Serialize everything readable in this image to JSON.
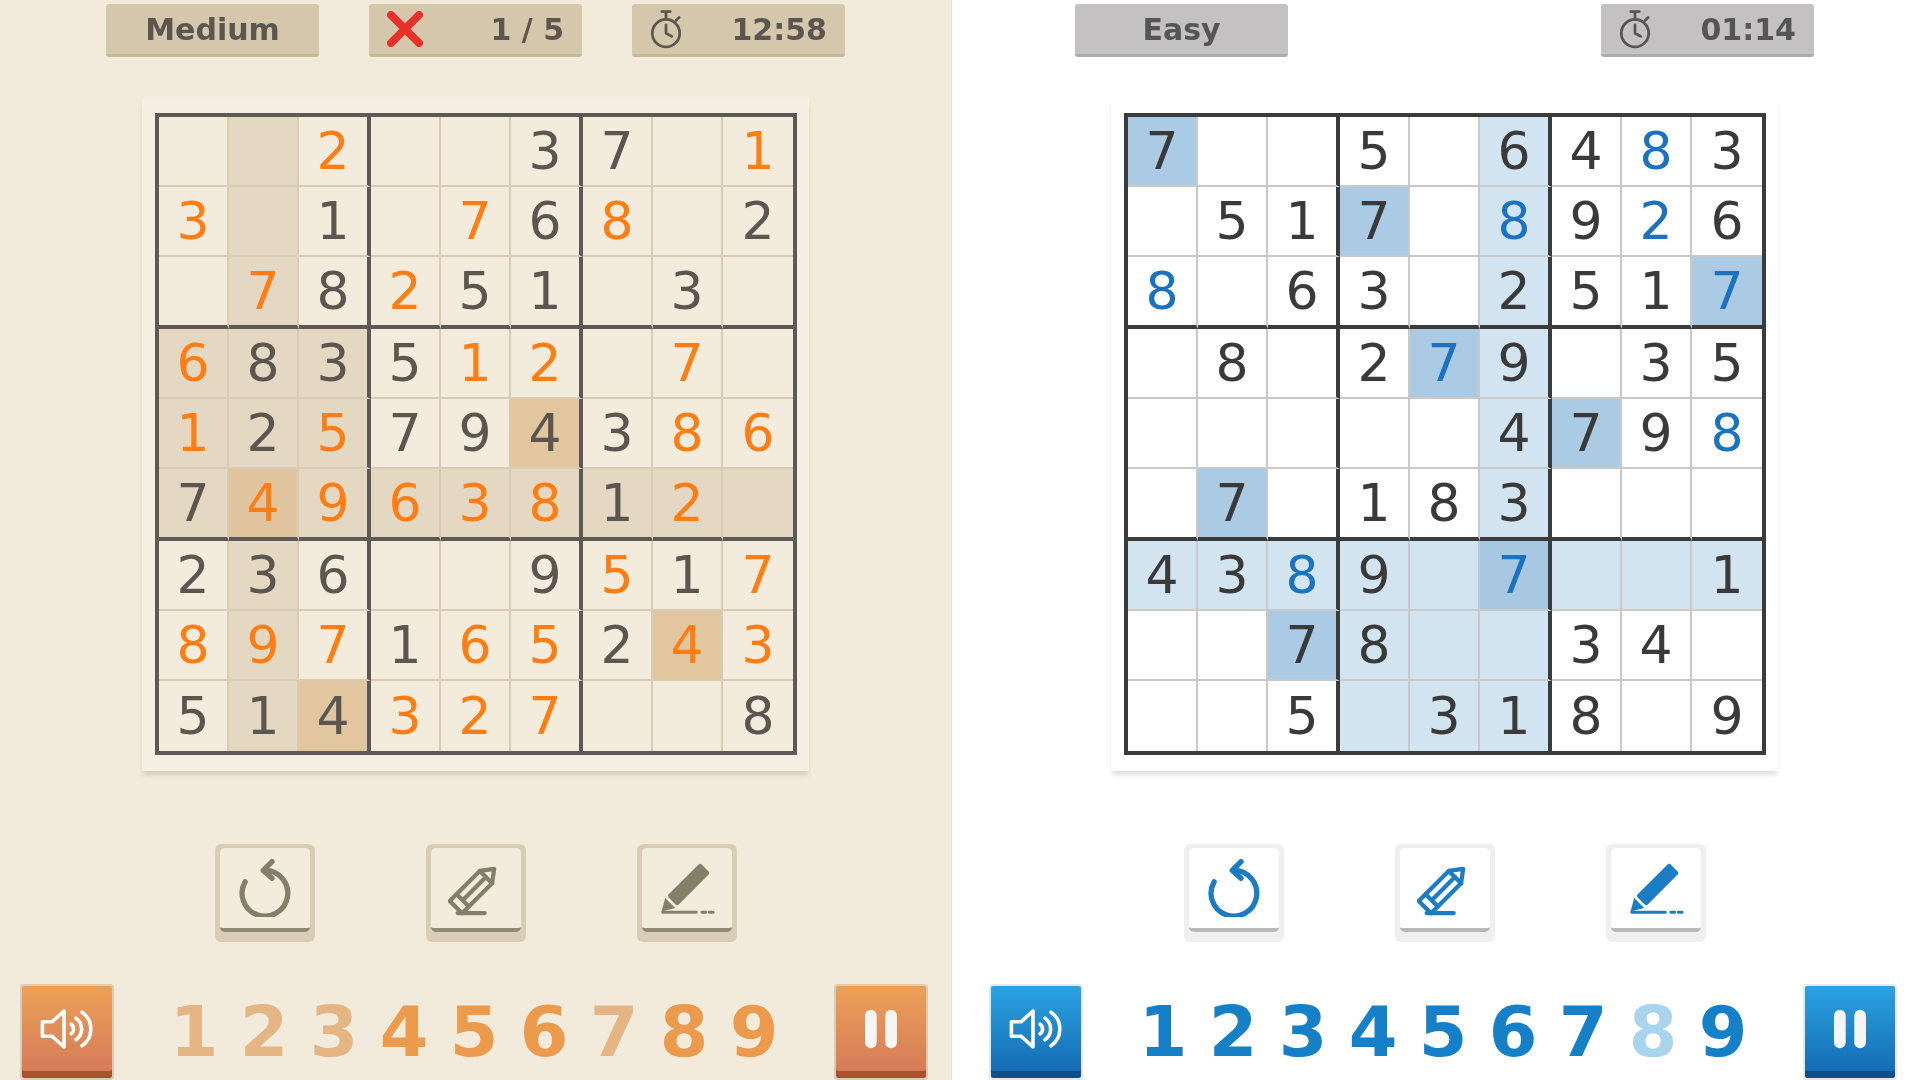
{
  "panels": [
    {
      "kind": "warm",
      "header": {
        "difficulty": "Medium",
        "mistakes": "1 / 5",
        "timer": "12:58"
      },
      "grid": [
        [
          {
            "kind": "empty",
            "highlighted": false,
            "matching": false
          },
          {
            "kind": "empty",
            "highlighted": true,
            "matching": false
          },
          {
            "value": "2",
            "kind": "entered",
            "highlighted": false,
            "matching": false
          },
          {
            "kind": "empty",
            "highlighted": false,
            "matching": false
          },
          {
            "kind": "empty",
            "highlighted": false,
            "matching": false
          },
          {
            "value": "3",
            "kind": "given",
            "highlighted": false,
            "matching": false
          },
          {
            "value": "7",
            "kind": "given",
            "highlighted": false,
            "matching": false
          },
          {
            "kind": "empty",
            "highlighted": false,
            "matching": false
          },
          {
            "value": "1",
            "kind": "entered",
            "highlighted": false,
            "matching": false
          }
        ],
        [
          {
            "value": "3",
            "kind": "entered",
            "highlighted": false,
            "matching": false
          },
          {
            "kind": "empty",
            "highlighted": true,
            "matching": false
          },
          {
            "value": "1",
            "kind": "given",
            "highlighted": false,
            "matching": false
          },
          {
            "kind": "empty",
            "highlighted": false,
            "matching": false
          },
          {
            "value": "7",
            "kind": "entered",
            "highlighted": false,
            "matching": false
          },
          {
            "value": "6",
            "kind": "given",
            "highlighted": false,
            "matching": false
          },
          {
            "value": "8",
            "kind": "entered",
            "highlighted": false,
            "matching": false
          },
          {
            "kind": "empty",
            "highlighted": false,
            "matching": false
          },
          {
            "value": "2",
            "kind": "given",
            "highlighted": false,
            "matching": false
          }
        ],
        [
          {
            "kind": "empty",
            "highlighted": false,
            "matching": false
          },
          {
            "value": "7",
            "kind": "entered",
            "highlighted": true,
            "matching": false
          },
          {
            "value": "8",
            "kind": "given",
            "highlighted": false,
            "matching": false
          },
          {
            "value": "2",
            "kind": "entered",
            "highlighted": false,
            "matching": false
          },
          {
            "value": "5",
            "kind": "given",
            "highlighted": false,
            "matching": false
          },
          {
            "value": "1",
            "kind": "given",
            "highlighted": false,
            "matching": false
          },
          {
            "kind": "empty",
            "highlighted": false,
            "matching": false
          },
          {
            "value": "3",
            "kind": "given",
            "highlighted": false,
            "matching": false
          },
          {
            "kind": "empty",
            "highlighted": false,
            "matching": false
          }
        ],
        [
          {
            "value": "6",
            "kind": "entered",
            "highlighted": true,
            "matching": false
          },
          {
            "value": "8",
            "kind": "given",
            "highlighted": true,
            "matching": false
          },
          {
            "value": "3",
            "kind": "given",
            "highlighted": true,
            "matching": false
          },
          {
            "value": "5",
            "kind": "given",
            "highlighted": false,
            "matching": false
          },
          {
            "value": "1",
            "kind": "entered",
            "highlighted": false,
            "matching": false
          },
          {
            "value": "2",
            "kind": "entered",
            "highlighted": false,
            "matching": false
          },
          {
            "kind": "empty",
            "highlighted": false,
            "matching": false
          },
          {
            "value": "7",
            "kind": "entered",
            "highlighted": false,
            "matching": false
          },
          {
            "kind": "empty",
            "highlighted": false,
            "matching": false
          }
        ],
        [
          {
            "value": "1",
            "kind": "entered",
            "highlighted": true,
            "matching": false
          },
          {
            "value": "2",
            "kind": "given",
            "highlighted": true,
            "matching": false
          },
          {
            "value": "5",
            "kind": "entered",
            "highlighted": true,
            "matching": false
          },
          {
            "value": "7",
            "kind": "given",
            "highlighted": false,
            "matching": false
          },
          {
            "value": "9",
            "kind": "given",
            "highlighted": false,
            "matching": false
          },
          {
            "value": "4",
            "kind": "given",
            "highlighted": false,
            "matching": true
          },
          {
            "value": "3",
            "kind": "given",
            "highlighted": false,
            "matching": false
          },
          {
            "value": "8",
            "kind": "entered",
            "highlighted": false,
            "matching": false
          },
          {
            "value": "6",
            "kind": "entered",
            "highlighted": false,
            "matching": false
          }
        ],
        [
          {
            "value": "7",
            "kind": "given",
            "highlighted": true,
            "matching": false
          },
          {
            "value": "4",
            "kind": "entered",
            "highlighted": true,
            "matching": true
          },
          {
            "value": "9",
            "kind": "entered",
            "highlighted": true,
            "matching": false
          },
          {
            "value": "6",
            "kind": "entered",
            "highlighted": true,
            "matching": false
          },
          {
            "value": "3",
            "kind": "entered",
            "highlighted": true,
            "matching": false
          },
          {
            "value": "8",
            "kind": "entered",
            "highlighted": true,
            "matching": false
          },
          {
            "value": "1",
            "kind": "given",
            "highlighted": true,
            "matching": false
          },
          {
            "value": "2",
            "kind": "entered",
            "highlighted": true,
            "matching": false
          },
          {
            "kind": "empty",
            "highlighted": true,
            "matching": false
          }
        ],
        [
          {
            "value": "2",
            "kind": "given",
            "highlighted": false,
            "matching": false
          },
          {
            "value": "3",
            "kind": "given",
            "highlighted": true,
            "matching": false
          },
          {
            "value": "6",
            "kind": "given",
            "highlighted": false,
            "matching": false
          },
          {
            "kind": "empty",
            "highlighted": false,
            "matching": false
          },
          {
            "kind": "empty",
            "highlighted": false,
            "matching": false
          },
          {
            "value": "9",
            "kind": "given",
            "highlighted": false,
            "matching": false
          },
          {
            "value": "5",
            "kind": "entered",
            "highlighted": false,
            "matching": false
          },
          {
            "value": "1",
            "kind": "given",
            "highlighted": false,
            "matching": false
          },
          {
            "value": "7",
            "kind": "entered",
            "highlighted": false,
            "matching": false
          }
        ],
        [
          {
            "value": "8",
            "kind": "entered",
            "highlighted": false,
            "matching": false
          },
          {
            "value": "9",
            "kind": "entered",
            "highlighted": true,
            "matching": false
          },
          {
            "value": "7",
            "kind": "entered",
            "highlighted": false,
            "matching": false
          },
          {
            "value": "1",
            "kind": "given",
            "highlighted": false,
            "matching": false
          },
          {
            "value": "6",
            "kind": "entered",
            "highlighted": false,
            "matching": false
          },
          {
            "value": "5",
            "kind": "entered",
            "highlighted": false,
            "matching": false
          },
          {
            "value": "2",
            "kind": "given",
            "highlighted": false,
            "matching": false
          },
          {
            "value": "4",
            "kind": "entered",
            "highlighted": false,
            "matching": true
          },
          {
            "value": "3",
            "kind": "entered",
            "highlighted": false,
            "matching": false
          }
        ],
        [
          {
            "value": "5",
            "kind": "given",
            "highlighted": false,
            "matching": false
          },
          {
            "value": "1",
            "kind": "given",
            "highlighted": true,
            "matching": false
          },
          {
            "value": "4",
            "kind": "given",
            "highlighted": false,
            "matching": true
          },
          {
            "value": "3",
            "kind": "entered",
            "highlighted": false,
            "matching": false
          },
          {
            "value": "2",
            "kind": "entered",
            "highlighted": false,
            "matching": false
          },
          {
            "value": "7",
            "kind": "entered",
            "highlighted": false,
            "matching": false
          },
          {
            "kind": "empty",
            "highlighted": false,
            "matching": false
          },
          {
            "kind": "empty",
            "highlighted": false,
            "matching": false
          },
          {
            "value": "8",
            "kind": "given",
            "highlighted": false,
            "matching": false
          }
        ]
      ],
      "digits": [
        {
          "label": "1",
          "completed": true
        },
        {
          "label": "2",
          "completed": true
        },
        {
          "label": "3",
          "completed": true
        },
        {
          "label": "4",
          "completed": false
        },
        {
          "label": "5",
          "completed": false
        },
        {
          "label": "6",
          "completed": false
        },
        {
          "label": "7",
          "completed": true
        },
        {
          "label": "8",
          "completed": false
        },
        {
          "label": "9",
          "completed": false
        }
      ]
    },
    {
      "kind": "cool",
      "header": {
        "difficulty": "Easy",
        "timer": "01:14"
      },
      "grid": [
        [
          {
            "value": "7",
            "kind": "given",
            "highlighted": false,
            "matching": true
          },
          {
            "kind": "empty",
            "highlighted": false,
            "matching": false
          },
          {
            "kind": "empty",
            "highlighted": false,
            "matching": false
          },
          {
            "value": "5",
            "kind": "given",
            "highlighted": false,
            "matching": false
          },
          {
            "kind": "empty",
            "highlighted": false,
            "matching": false
          },
          {
            "value": "6",
            "kind": "given",
            "highlighted": true,
            "matching": false
          },
          {
            "value": "4",
            "kind": "given",
            "highlighted": false,
            "matching": false
          },
          {
            "value": "8",
            "kind": "entered",
            "highlighted": false,
            "matching": false
          },
          {
            "value": "3",
            "kind": "given",
            "highlighted": false,
            "matching": false
          }
        ],
        [
          {
            "kind": "empty",
            "highlighted": false,
            "matching": false
          },
          {
            "value": "5",
            "kind": "given",
            "highlighted": false,
            "matching": false
          },
          {
            "value": "1",
            "kind": "given",
            "highlighted": false,
            "matching": false
          },
          {
            "value": "7",
            "kind": "given",
            "highlighted": false,
            "matching": true
          },
          {
            "kind": "empty",
            "highlighted": false,
            "matching": false
          },
          {
            "value": "8",
            "kind": "entered",
            "highlighted": true,
            "matching": false
          },
          {
            "value": "9",
            "kind": "given",
            "highlighted": false,
            "matching": false
          },
          {
            "value": "2",
            "kind": "entered",
            "highlighted": false,
            "matching": false
          },
          {
            "value": "6",
            "kind": "given",
            "highlighted": false,
            "matching": false
          }
        ],
        [
          {
            "value": "8",
            "kind": "entered",
            "highlighted": false,
            "matching": false
          },
          {
            "kind": "empty",
            "highlighted": false,
            "matching": false
          },
          {
            "value": "6",
            "kind": "given",
            "highlighted": false,
            "matching": false
          },
          {
            "value": "3",
            "kind": "given",
            "highlighted": false,
            "matching": false
          },
          {
            "kind": "empty",
            "highlighted": false,
            "matching": false
          },
          {
            "value": "2",
            "kind": "given",
            "highlighted": true,
            "matching": false
          },
          {
            "value": "5",
            "kind": "given",
            "highlighted": false,
            "matching": false
          },
          {
            "value": "1",
            "kind": "given",
            "highlighted": false,
            "matching": false
          },
          {
            "value": "7",
            "kind": "entered",
            "highlighted": false,
            "matching": true
          }
        ],
        [
          {
            "kind": "empty",
            "highlighted": false,
            "matching": false
          },
          {
            "value": "8",
            "kind": "given",
            "highlighted": false,
            "matching": false
          },
          {
            "kind": "empty",
            "highlighted": false,
            "matching": false
          },
          {
            "value": "2",
            "kind": "given",
            "highlighted": false,
            "matching": false
          },
          {
            "value": "7",
            "kind": "entered",
            "highlighted": false,
            "matching": true
          },
          {
            "value": "9",
            "kind": "given",
            "highlighted": true,
            "matching": false
          },
          {
            "kind": "empty",
            "highlighted": false,
            "matching": false
          },
          {
            "value": "3",
            "kind": "given",
            "highlighted": false,
            "matching": false
          },
          {
            "value": "5",
            "kind": "given",
            "highlighted": false,
            "matching": false
          }
        ],
        [
          {
            "kind": "empty",
            "highlighted": false,
            "matching": false
          },
          {
            "kind": "empty",
            "highlighted": false,
            "matching": false
          },
          {
            "kind": "empty",
            "highlighted": false,
            "matching": false
          },
          {
            "kind": "empty",
            "highlighted": false,
            "matching": false
          },
          {
            "kind": "empty",
            "highlighted": false,
            "matching": false
          },
          {
            "value": "4",
            "kind": "given",
            "highlighted": true,
            "matching": false
          },
          {
            "value": "7",
            "kind": "given",
            "highlighted": false,
            "matching": true
          },
          {
            "value": "9",
            "kind": "given",
            "highlighted": false,
            "matching": false
          },
          {
            "value": "8",
            "kind": "entered",
            "highlighted": false,
            "matching": false
          }
        ],
        [
          {
            "kind": "empty",
            "highlighted": false,
            "matching": false
          },
          {
            "value": "7",
            "kind": "given",
            "highlighted": false,
            "matching": true
          },
          {
            "kind": "empty",
            "highlighted": false,
            "matching": false
          },
          {
            "value": "1",
            "kind": "given",
            "highlighted": false,
            "matching": false
          },
          {
            "value": "8",
            "kind": "given",
            "highlighted": false,
            "matching": false
          },
          {
            "value": "3",
            "kind": "given",
            "highlighted": true,
            "matching": false
          },
          {
            "kind": "empty",
            "highlighted": false,
            "matching": false
          },
          {
            "kind": "empty",
            "highlighted": false,
            "matching": false
          },
          {
            "kind": "empty",
            "highlighted": false,
            "matching": false
          }
        ],
        [
          {
            "value": "4",
            "kind": "given",
            "highlighted": true,
            "matching": false
          },
          {
            "value": "3",
            "kind": "given",
            "highlighted": true,
            "matching": false
          },
          {
            "value": "8",
            "kind": "entered",
            "highlighted": true,
            "matching": false
          },
          {
            "value": "9",
            "kind": "given",
            "highlighted": true,
            "matching": false
          },
          {
            "kind": "empty",
            "highlighted": true,
            "matching": false
          },
          {
            "value": "7",
            "kind": "entered",
            "highlighted": true,
            "matching": true
          },
          {
            "kind": "empty",
            "highlighted": true,
            "matching": false
          },
          {
            "kind": "empty",
            "highlighted": true,
            "matching": false
          },
          {
            "value": "1",
            "kind": "given",
            "highlighted": true,
            "matching": false
          }
        ],
        [
          {
            "kind": "empty",
            "highlighted": false,
            "matching": false
          },
          {
            "kind": "empty",
            "highlighted": false,
            "matching": false
          },
          {
            "value": "7",
            "kind": "given",
            "highlighted": false,
            "matching": true
          },
          {
            "value": "8",
            "kind": "given",
            "highlighted": true,
            "matching": false
          },
          {
            "kind": "empty",
            "highlighted": true,
            "matching": false
          },
          {
            "kind": "empty",
            "highlighted": true,
            "matching": false
          },
          {
            "value": "3",
            "kind": "given",
            "highlighted": false,
            "matching": false
          },
          {
            "value": "4",
            "kind": "given",
            "highlighted": false,
            "matching": false
          },
          {
            "kind": "empty",
            "highlighted": false,
            "matching": false
          }
        ],
        [
          {
            "kind": "empty",
            "highlighted": false,
            "matching": false
          },
          {
            "kind": "empty",
            "highlighted": false,
            "matching": false
          },
          {
            "value": "5",
            "kind": "given",
            "highlighted": false,
            "matching": false
          },
          {
            "kind": "empty",
            "highlighted": true,
            "matching": false
          },
          {
            "value": "3",
            "kind": "given",
            "highlighted": true,
            "matching": false
          },
          {
            "value": "1",
            "kind": "given",
            "highlighted": true,
            "matching": false
          },
          {
            "value": "8",
            "kind": "given",
            "highlighted": false,
            "matching": false
          },
          {
            "kind": "empty",
            "highlighted": false,
            "matching": false
          },
          {
            "value": "9",
            "kind": "given",
            "highlighted": false,
            "matching": false
          }
        ]
      ],
      "digits": [
        {
          "label": "1",
          "completed": false
        },
        {
          "label": "2",
          "completed": false
        },
        {
          "label": "3",
          "completed": false
        },
        {
          "label": "4",
          "completed": false
        },
        {
          "label": "5",
          "completed": false
        },
        {
          "label": "6",
          "completed": false
        },
        {
          "label": "7",
          "completed": false
        },
        {
          "label": "8",
          "completed": true
        },
        {
          "label": "9",
          "completed": false
        }
      ]
    }
  ]
}
